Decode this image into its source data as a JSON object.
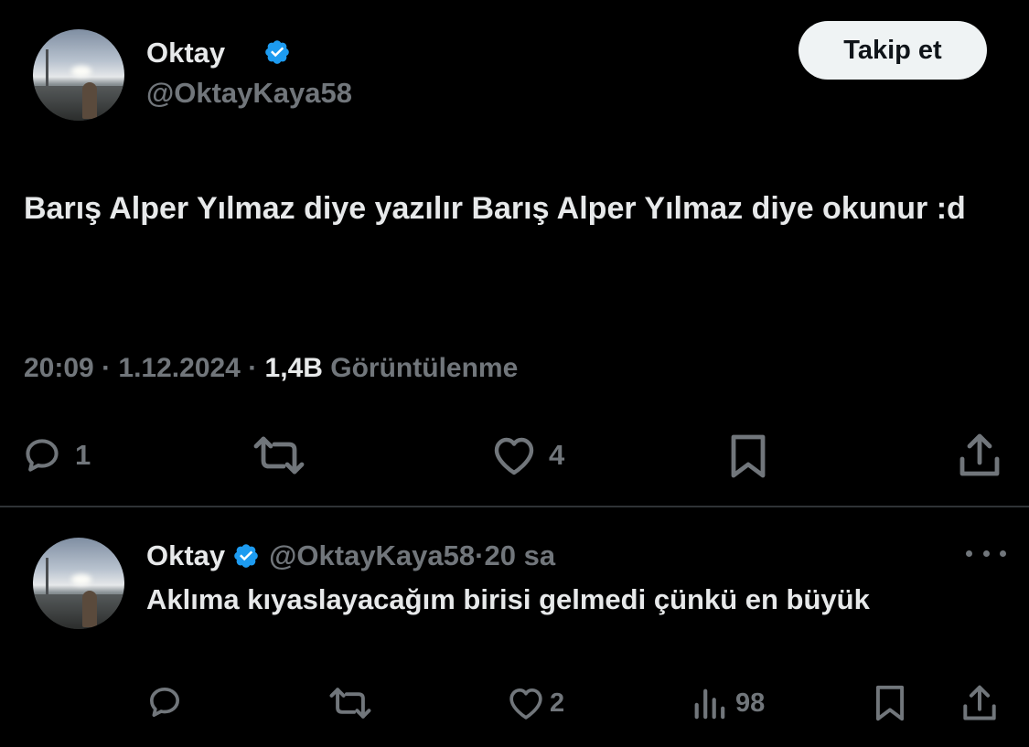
{
  "tweet": {
    "author_name": "Oktay",
    "author_handle": "@OktayKaya58",
    "follow_label": "Takip et",
    "text": "Barış Alper Yılmaz diye yazılır Barış Alper Yılmaz diye okunur :d",
    "time": "20:09",
    "separator": " · ",
    "date": "1.12.2024",
    "views_count": "1,4B",
    "views_label": "Görüntülenme",
    "replies": "1",
    "likes": "4",
    "icons": [
      "reply-icon",
      "retweet-icon",
      "like-icon",
      "bookmark-icon",
      "share-icon",
      "verified-icon"
    ]
  },
  "reply": {
    "author_name": "Oktay",
    "author_handle": "@OktayKaya58",
    "separator": " · ",
    "time_ago": "20 sa",
    "text": "Aklıma kıyaslayacağım birisi gelmedi çünkü en büyük",
    "likes": "2",
    "views": "98",
    "icons": [
      "reply-icon",
      "retweet-icon",
      "like-icon",
      "views-icon",
      "bookmark-icon",
      "share-icon",
      "more-icon"
    ]
  },
  "colors": {
    "background": "#000000",
    "text": "#e7e9ea",
    "muted": "#71767b",
    "verified": "#1d9bf0",
    "button_bg": "#eff3f4"
  }
}
